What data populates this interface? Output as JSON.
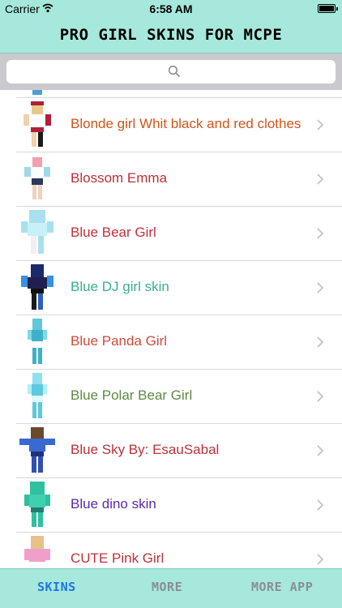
{
  "status_bar": {
    "carrier": "Carrier",
    "time": "6:58 AM"
  },
  "nav": {
    "title": "PRO GIRL SKINS FOR MCPE"
  },
  "search": {
    "icon": "search-icon"
  },
  "list": [
    {
      "label": "Blonde girl Whit black and red clothes",
      "color": "#d2541a"
    },
    {
      "label": "Blossom Emma",
      "color": "#b8323a"
    },
    {
      "label": "Blue Bear Girl",
      "color": "#c2303a"
    },
    {
      "label": "Blue DJ girl skin",
      "color": "#38b18c"
    },
    {
      "label": "Blue Panda Girl",
      "color": "#d24a3a"
    },
    {
      "label": "Blue Polar Bear Girl",
      "color": "#5c8a45"
    },
    {
      "label": "Blue Sky By: EsauSabal",
      "color": "#b8323a"
    },
    {
      "label": "Blue dino skin",
      "color": "#5a2ab0"
    },
    {
      "label": "CUTE Pink Girl",
      "color": "#c2303a"
    }
  ],
  "tabs": [
    {
      "label": "SKINS",
      "active": true
    },
    {
      "label": "MORE",
      "active": false
    },
    {
      "label": "MORE APP",
      "active": false
    }
  ],
  "colors": {
    "bar_bg": "#a6e8dc",
    "active_tab": "#1e74e6",
    "inactive_tab": "#8a8e95"
  }
}
